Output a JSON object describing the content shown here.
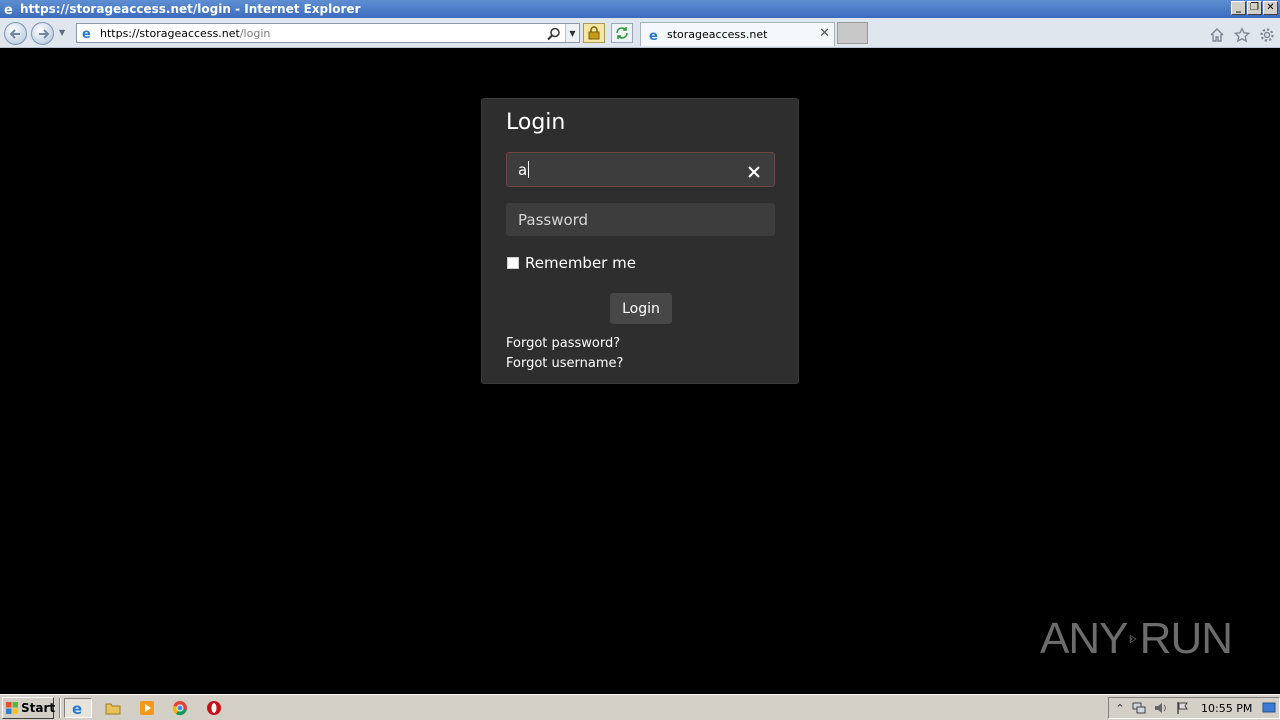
{
  "window": {
    "title": "https://storageaccess.net/login - Internet Explorer",
    "controls": {
      "minimize": "_",
      "restore": "❐",
      "close": "✕"
    }
  },
  "toolbar": {
    "url_host": "https://storageaccess.net",
    "url_path": "/login",
    "tab_label": "storageaccess.net",
    "tab_close": "✕"
  },
  "login": {
    "title": "Login",
    "username_value": "a",
    "password_placeholder": "Password",
    "remember_label": "Remember me",
    "remember_checked": false,
    "button_label": "Login",
    "forgot_password": "Forgot password?",
    "forgot_username": "Forgot username?"
  },
  "watermark": {
    "text_left": "ANY",
    "text_right": "RUN"
  },
  "taskbar": {
    "start_label": "Start",
    "apps": [
      "internet-explorer",
      "file-explorer",
      "media-player",
      "chrome",
      "opera"
    ],
    "clock": "10:55 PM"
  },
  "colors": {
    "page_bg": "#000000",
    "card_bg": "#2e2e2e",
    "field_bg": "#3d3d3d",
    "button_bg": "#474747",
    "focused_border": "#6e4444"
  }
}
